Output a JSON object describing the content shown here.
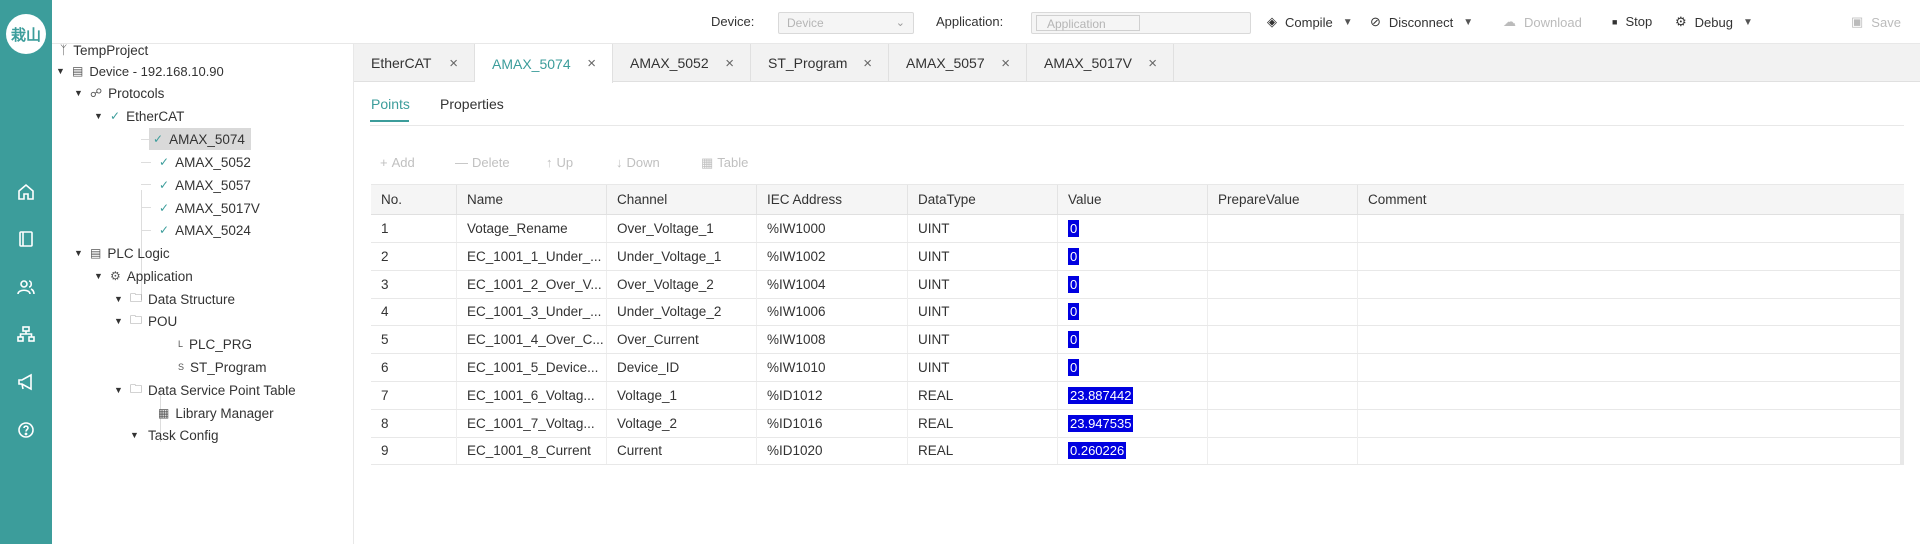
{
  "logo_text": "栽山",
  "rail": {
    "icons": [
      "home-icon",
      "book-icon",
      "users-icon",
      "network-icon",
      "megaphone-icon",
      "help-icon"
    ]
  },
  "toolbar": {
    "device_label": "Device",
    "device_colon": ":",
    "device_placeholder": "Device",
    "application_label": "Application",
    "application_colon": ":",
    "application_placeholder": "Application",
    "compile": "Compile",
    "disconnect": "Disconnect",
    "download": "Download",
    "stop": "Stop",
    "debug": "Debug",
    "save": "Save"
  },
  "tree": {
    "project": "TempProject",
    "device": "Device - 192.168.10.90",
    "protocols": "Protocols",
    "ethercat": "EtherCAT",
    "modules": [
      "AMAX_5074",
      "AMAX_5052",
      "AMAX_5057",
      "AMAX_5017V",
      "AMAX_5024"
    ],
    "plc_logic": "PLC Logic",
    "application": "Application",
    "data_structure": "Data Structure",
    "pou": "POU",
    "plc_prg": "PLC_PRG",
    "plc_prg_badge": "L",
    "st_program": "ST_Program",
    "st_program_badge": "S",
    "data_service": "Data Service Point Table",
    "library": "Library Manager",
    "task_config": "Task Config"
  },
  "tabs": [
    "EtherCAT",
    "AMAX_5074",
    "AMAX_5052",
    "ST_Program",
    "AMAX_5057",
    "AMAX_5017V"
  ],
  "active_tab": "AMAX_5074",
  "subtabs": {
    "points": "Points",
    "properties": "Properties"
  },
  "table_toolbar": {
    "add": "Add",
    "delete": "Delete",
    "up": "Up",
    "down": "Down",
    "table": "Table"
  },
  "table": {
    "headers": [
      "No.",
      "Name",
      "Channel",
      "IEC Address",
      "DataType",
      "Value",
      "PrepareValue",
      "Comment"
    ],
    "rows": [
      [
        "1",
        "Votage_Rename",
        "Over_Voltage_1",
        "%IW1000",
        "UINT",
        "0"
      ],
      [
        "2",
        "EC_1001_1_Under_...",
        "Under_Voltage_1",
        "%IW1002",
        "UINT",
        "0"
      ],
      [
        "3",
        "EC_1001_2_Over_V...",
        "Over_Voltage_2",
        "%IW1004",
        "UINT",
        "0"
      ],
      [
        "4",
        "EC_1001_3_Under_...",
        "Under_Voltage_2",
        "%IW1006",
        "UINT",
        "0"
      ],
      [
        "5",
        "EC_1001_4_Over_C...",
        "Over_Current",
        "%IW1008",
        "UINT",
        "0"
      ],
      [
        "6",
        "EC_1001_5_Device...",
        "Device_ID",
        "%IW1010",
        "UINT",
        "0"
      ],
      [
        "7",
        "EC_1001_6_Voltag...",
        "Voltage_1",
        "%ID1012",
        "REAL",
        "23.887442"
      ],
      [
        "8",
        "EC_1001_7_Voltag...",
        "Voltage_2",
        "%ID1016",
        "REAL",
        "23.947535"
      ],
      [
        "9",
        "EC_1001_8_Current",
        "Current",
        "%ID1020",
        "REAL",
        "0.260226"
      ]
    ]
  },
  "colors": {
    "accent": "#3c9d9b",
    "value_highlight": "#0000e0"
  }
}
